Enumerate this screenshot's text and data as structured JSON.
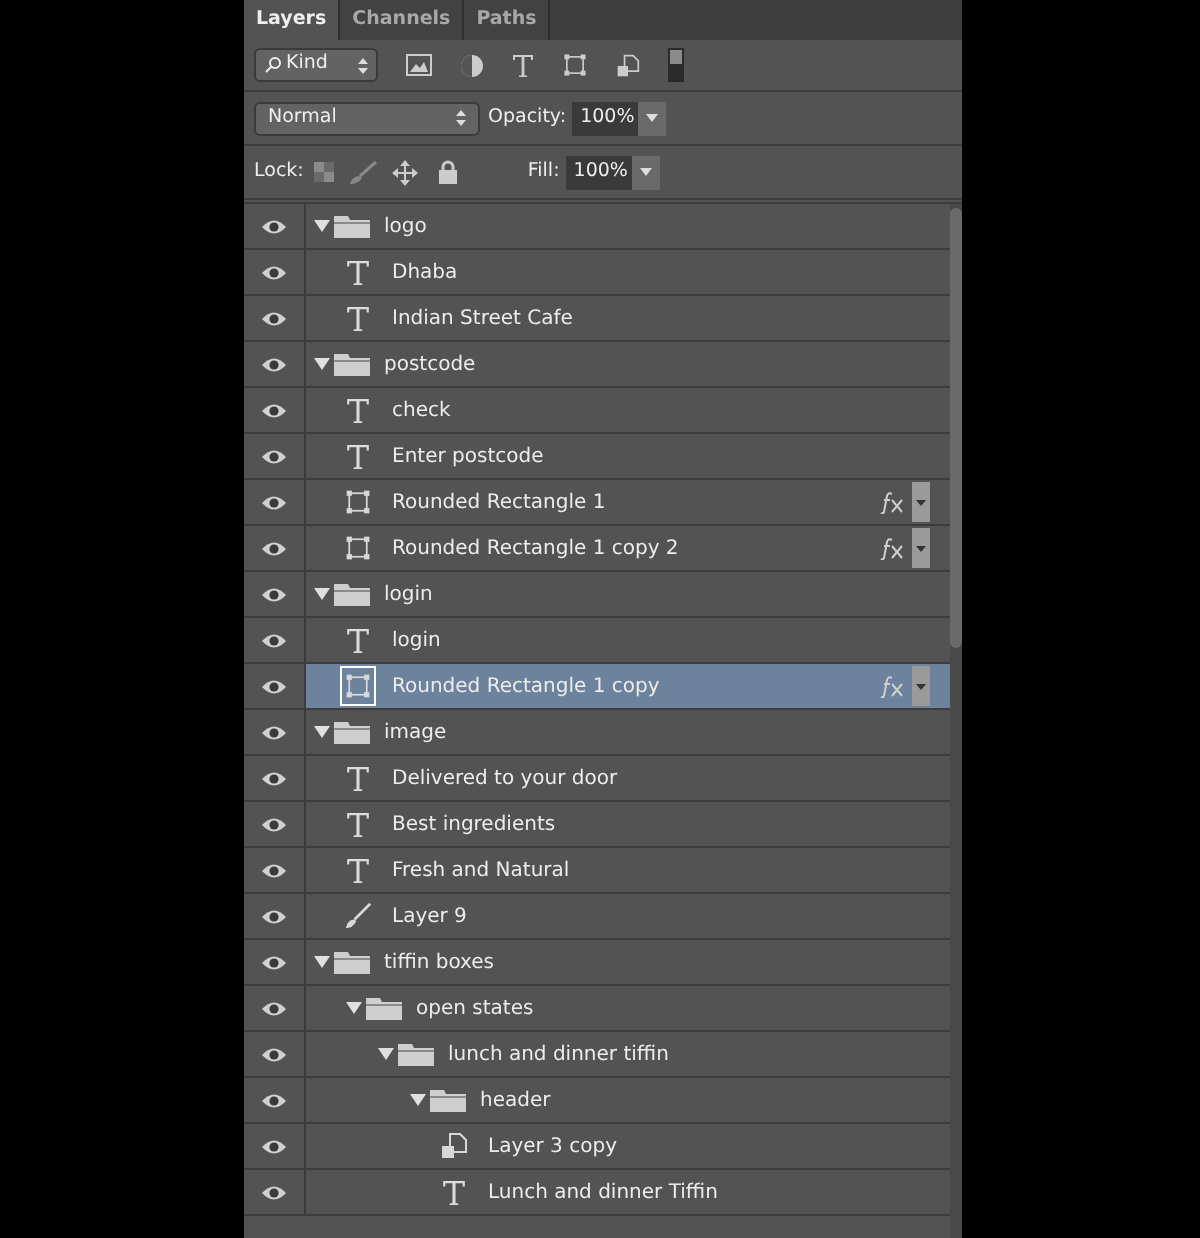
{
  "tabs": [
    {
      "label": "Layers",
      "selected": true
    },
    {
      "label": "Channels",
      "selected": false
    },
    {
      "label": "Paths",
      "selected": false
    }
  ],
  "filter": {
    "value": "Kind"
  },
  "blend_mode": {
    "value": "Normal"
  },
  "opacity": {
    "label": "Opacity:",
    "value": "100%"
  },
  "lock": {
    "label": "Lock:"
  },
  "fill": {
    "label": "Fill:",
    "value": "100%"
  },
  "layers": [
    {
      "kind": "group",
      "name": "logo",
      "visible": true,
      "expanded": true,
      "selected": false,
      "children": [
        {
          "kind": "text",
          "name": "Dhaba",
          "visible": true,
          "selected": false
        },
        {
          "kind": "text",
          "name": "Indian Street Cafe",
          "visible": true,
          "selected": false
        }
      ]
    },
    {
      "kind": "group",
      "name": "postcode",
      "visible": true,
      "expanded": true,
      "selected": false,
      "children": [
        {
          "kind": "text",
          "name": "check",
          "visible": true,
          "selected": false
        },
        {
          "kind": "text",
          "name": "Enter postcode",
          "visible": true,
          "selected": false
        },
        {
          "kind": "shape",
          "name": "Rounded Rectangle 1",
          "visible": true,
          "selected": false,
          "fx": true
        },
        {
          "kind": "shape",
          "name": "Rounded Rectangle 1 copy 2",
          "visible": true,
          "selected": false,
          "fx": true
        }
      ]
    },
    {
      "kind": "group",
      "name": "login",
      "visible": true,
      "expanded": true,
      "selected": false,
      "children": [
        {
          "kind": "text",
          "name": "login",
          "visible": true,
          "selected": false
        },
        {
          "kind": "shape",
          "name": "Rounded Rectangle 1 copy",
          "visible": true,
          "selected": true,
          "fx": true
        }
      ]
    },
    {
      "kind": "group",
      "name": "image",
      "visible": true,
      "expanded": true,
      "selected": false,
      "children": [
        {
          "kind": "text",
          "name": "Delivered to your door",
          "visible": true,
          "selected": false
        },
        {
          "kind": "text",
          "name": "Best ingredients",
          "visible": true,
          "selected": false
        },
        {
          "kind": "text",
          "name": "Fresh and Natural",
          "visible": true,
          "selected": false
        },
        {
          "kind": "paint",
          "name": "Layer 9",
          "visible": true,
          "selected": false
        }
      ]
    },
    {
      "kind": "group",
      "name": "tiffin boxes",
      "visible": true,
      "expanded": true,
      "selected": false,
      "children": [
        {
          "kind": "group",
          "name": "open states",
          "visible": true,
          "expanded": true,
          "selected": false,
          "children": [
            {
              "kind": "group",
              "name": "lunch and dinner tiffin",
              "visible": true,
              "expanded": true,
              "selected": false,
              "children": [
                {
                  "kind": "group",
                  "name": "header",
                  "visible": true,
                  "expanded": true,
                  "selected": false,
                  "children": [
                    {
                      "kind": "smart",
                      "name": "Layer 3 copy",
                      "visible": true,
                      "selected": false
                    },
                    {
                      "kind": "text",
                      "name": "Lunch and dinner Tiffin",
                      "visible": true,
                      "selected": false
                    }
                  ]
                }
              ]
            }
          ]
        }
      ]
    }
  ]
}
